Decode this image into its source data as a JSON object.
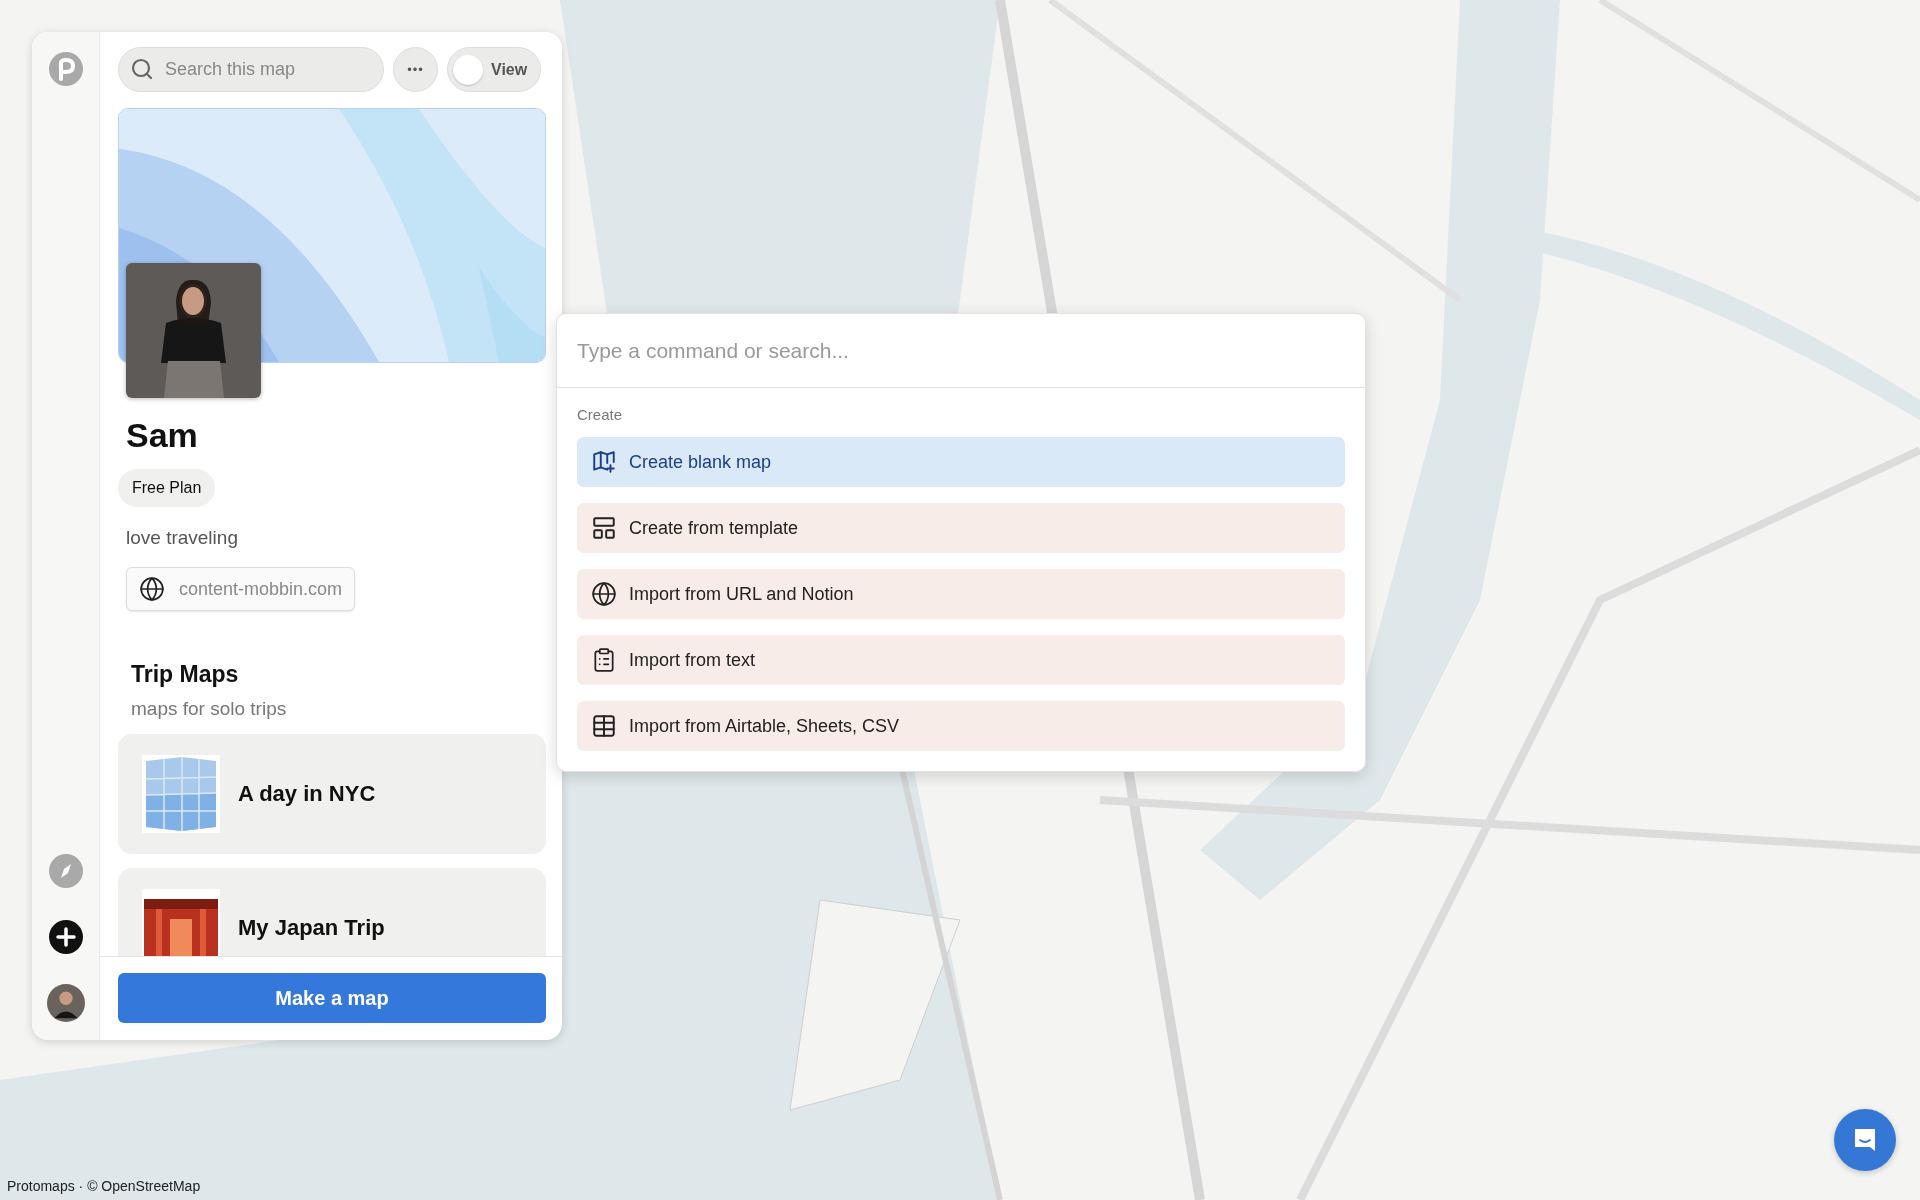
{
  "search": {
    "placeholder": "Search this map"
  },
  "more_button": "•••",
  "view_toggle": {
    "label": "View",
    "on": false
  },
  "profile": {
    "name": "Sam",
    "plan": "Free Plan",
    "bio": "love traveling",
    "website": "content-mobbin.com"
  },
  "collection": {
    "title": "Trip Maps",
    "subtitle": "maps for solo trips",
    "maps": [
      {
        "title": "A day in NYC"
      },
      {
        "title": "My Japan Trip"
      }
    ]
  },
  "make_map_button": "Make a map",
  "command_palette": {
    "placeholder": "Type a command or search...",
    "section": "Create",
    "items": [
      {
        "kind": "blank-map",
        "label": "Create blank map",
        "selected": true
      },
      {
        "kind": "template",
        "label": "Create from template",
        "selected": false
      },
      {
        "kind": "url",
        "label": "Import from URL and Notion",
        "selected": false
      },
      {
        "kind": "text",
        "label": "Import from text",
        "selected": false
      },
      {
        "kind": "table",
        "label": "Import from Airtable, Sheets, CSV",
        "selected": false
      }
    ]
  },
  "attribution": "Protomaps · © OpenStreetMap"
}
